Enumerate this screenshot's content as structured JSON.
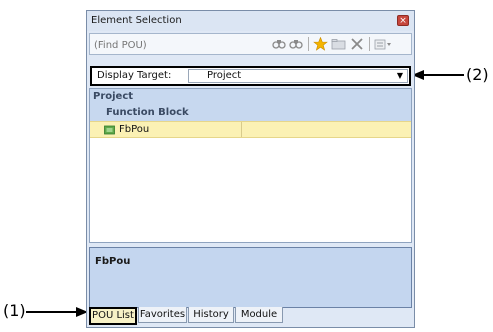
{
  "panel": {
    "title": "Element Selection",
    "close_symbol": "×",
    "search": {
      "placeholder": "(Find POU)"
    },
    "toolbar_icons": [
      "find-icon",
      "find-next-icon",
      "favorites-star-icon",
      "folder-icon",
      "delete-icon",
      "display-options-icon"
    ],
    "display_target": {
      "label": "Display Target:",
      "value": "Project"
    },
    "tree": {
      "header1": "Project",
      "header2": "Function Block",
      "items": [
        {
          "label": "FbPou",
          "selected": true
        }
      ]
    },
    "info": {
      "name": "FbPou"
    },
    "tabs": [
      {
        "label": "POU List",
        "active": true
      },
      {
        "label": "Favorites",
        "active": false
      },
      {
        "label": "History",
        "active": false
      },
      {
        "label": "Module",
        "active": false
      }
    ]
  },
  "callouts": {
    "left": "(1)",
    "right": "(2)"
  },
  "colors": {
    "panel_bg": "#dfe8f5",
    "header_bg": "#c7d8ef",
    "selected_row": "#fbf1b4",
    "info_bg": "#c4d6ef",
    "active_tab": "#f7f1c6",
    "close_button": "#c6463c"
  }
}
